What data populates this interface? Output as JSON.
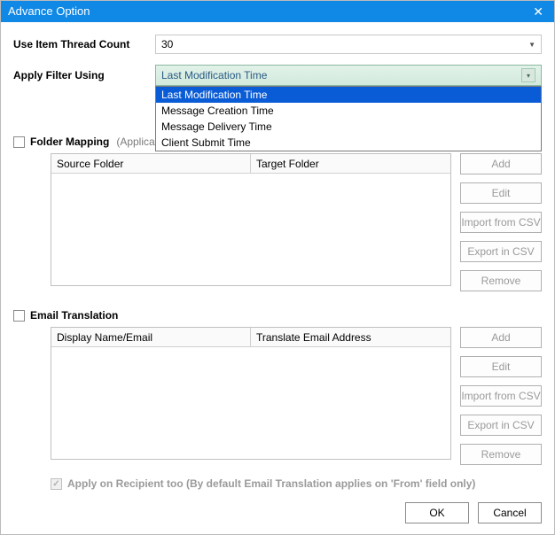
{
  "window": {
    "title": "Advance Option"
  },
  "thread": {
    "label": "Use Item Thread Count",
    "value": "30"
  },
  "filter": {
    "label": "Apply Filter Using",
    "selected": "Last Modification Time",
    "options": [
      "Last Modification Time",
      "Message Creation Time",
      "Message Delivery Time",
      "Client Submit Time"
    ]
  },
  "folderMapping": {
    "title": "Folder Mapping",
    "hint": "(Applicable only on Root Folders)",
    "cols": [
      "Source Folder",
      "Target Folder"
    ],
    "buttons": [
      "Add",
      "Edit",
      "Import from CSV",
      "Export in CSV",
      "Remove"
    ]
  },
  "emailTranslation": {
    "title": "Email Translation",
    "cols": [
      "Display Name/Email",
      "Translate Email Address"
    ],
    "buttons": [
      "Add",
      "Edit",
      "Import from CSV",
      "Export in CSV",
      "Remove"
    ],
    "note": "Apply on Recipient too (By default Email Translation applies on 'From' field only)"
  },
  "footer": {
    "ok": "OK",
    "cancel": "Cancel"
  }
}
